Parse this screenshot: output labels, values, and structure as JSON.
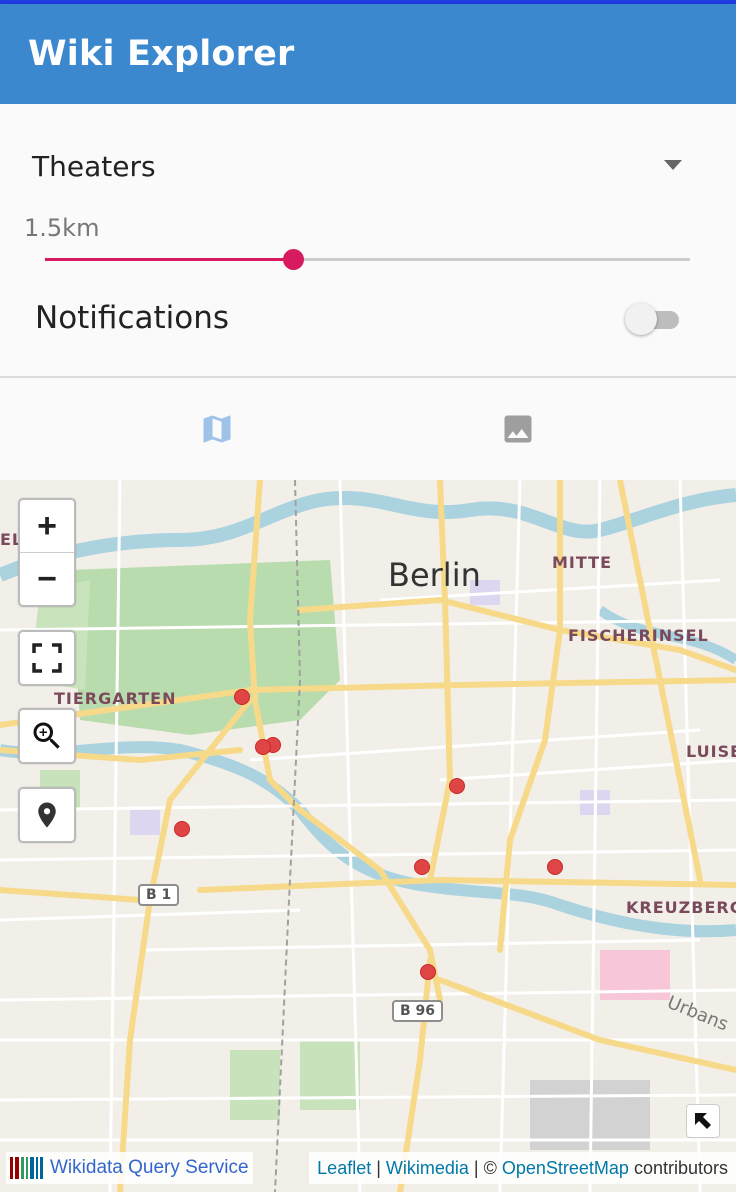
{
  "app": {
    "title": "Wiki Explorer"
  },
  "filter": {
    "category": "Theaters",
    "radius_label": "1.5km",
    "radius_fraction": 0.385
  },
  "notifications": {
    "label": "Notifications",
    "enabled": false
  },
  "tabs": [
    {
      "icon": "map-icon",
      "active": true
    },
    {
      "icon": "image-icon",
      "active": false
    }
  ],
  "map": {
    "controls": {
      "zoom_in": "+",
      "zoom_out": "−"
    },
    "labels": {
      "city": "Berlin",
      "mitte": "MITTE",
      "fischerinsel": "FISCHERINSEL",
      "tiergarten": "TIERGARTEN",
      "luise": "LUISE",
      "kreuzberg": "KREUZBERG",
      "urbans": "Urbans",
      "el": "EL"
    },
    "shields": {
      "b1": "B 1",
      "b96": "B 96"
    },
    "attribution": {
      "query_service": "Wikidata Query Service",
      "leaflet": "Leaflet",
      "sep1": " | ",
      "wikimedia": "Wikimedia",
      "sep2": " | © ",
      "osm": "OpenStreetMap",
      "contributors": " contributors"
    }
  },
  "colors": {
    "app_bar": "#3b88cf",
    "accent": "#d81b60",
    "marker": "#e04545",
    "tab_active": "#9ec3e8",
    "tab_inactive": "#9e9e9e"
  }
}
